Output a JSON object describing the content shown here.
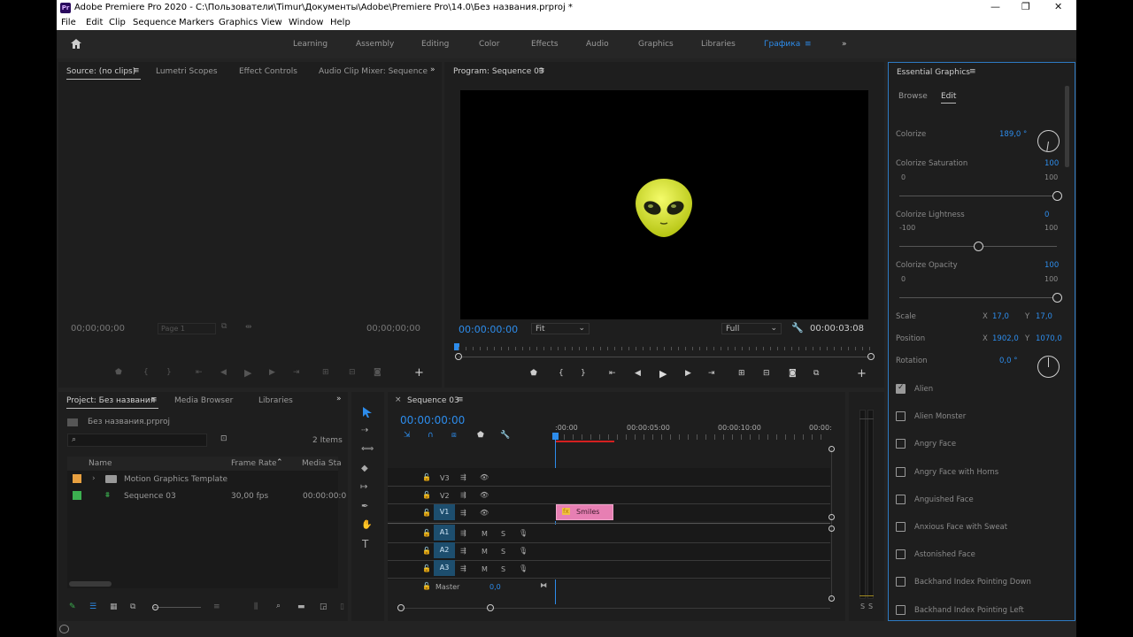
{
  "window": {
    "app_badge": "Pr",
    "title": "Adobe Premiere Pro 2020 - C:\\Пользователи\\Timur\\Документы\\Adobe\\Premiere Pro\\14.0\\Без названия.prproj *",
    "minimize": "—",
    "restore": "❐",
    "close": "✕"
  },
  "menu": [
    "File",
    "Edit",
    "Clip",
    "Sequence",
    "Markers",
    "Graphics",
    "View",
    "Window",
    "Help"
  ],
  "workspaces": [
    "Learning",
    "Assembly",
    "Editing",
    "Color",
    "Effects",
    "Audio",
    "Graphics",
    "Libraries",
    "Графика"
  ],
  "workspace_active": "Графика",
  "source_panel": {
    "tabs": [
      "Source: (no clips)",
      "Lumetri Scopes",
      "Effect Controls",
      "Audio Clip Mixer: Sequence"
    ],
    "timecode_left": "00;00;00;00",
    "page": "Page 1",
    "timecode_right": "00;00;00;00"
  },
  "program_panel": {
    "tab": "Program: Sequence 03",
    "timecode": "00:00:00:00",
    "fit": "Fit",
    "quality": "Full",
    "duration": "00:00:03:08"
  },
  "essential_graphics": {
    "title": "Essential Graphics",
    "tabs": [
      "Browse",
      "Edit"
    ],
    "colorize": {
      "label": "Colorize",
      "value": "189,0 °"
    },
    "saturation": {
      "label": "Colorize Saturation",
      "value": "100",
      "min": "0",
      "max": "100",
      "fraction": 1.0
    },
    "lightness": {
      "label": "Colorize Lightness",
      "value": "0",
      "min": "-100",
      "max": "100",
      "fraction": 0.5
    },
    "opacity": {
      "label": "Colorize Opacity",
      "value": "100",
      "min": "0",
      "max": "100",
      "fraction": 1.0
    },
    "scale": {
      "label": "Scale",
      "x_label": "X",
      "x": "17,0",
      "y_label": "Y",
      "y": "17,0"
    },
    "position": {
      "label": "Position",
      "x_label": "X",
      "x": "1902,0",
      "y_label": "Y",
      "y": "1070,0"
    },
    "rotation": {
      "label": "Rotation",
      "value": "0,0 °"
    },
    "checkboxes": [
      {
        "label": "Alien",
        "checked": true
      },
      {
        "label": "Alien Monster",
        "checked": false
      },
      {
        "label": "Angry Face",
        "checked": false
      },
      {
        "label": "Angry Face with Horns",
        "checked": false
      },
      {
        "label": "Anguished Face",
        "checked": false
      },
      {
        "label": "Anxious Face with Sweat",
        "checked": false
      },
      {
        "label": "Astonished Face",
        "checked": false
      },
      {
        "label": "Backhand Index Pointing Down",
        "checked": false
      },
      {
        "label": "Backhand Index Pointing Left",
        "checked": false
      }
    ]
  },
  "project_panel": {
    "tabs": [
      "Project: Без названия",
      "Media Browser",
      "Libraries"
    ],
    "file": "Без названия.prproj",
    "items_count": "2 Items",
    "columns": [
      "Name",
      "Frame Rate",
      "Media Sta"
    ],
    "rows": [
      {
        "name": "Motion Graphics Template",
        "frame_rate": "",
        "media": "",
        "color": "#e8a040"
      },
      {
        "name": "Sequence 03",
        "frame_rate": "30,00 fps",
        "media": "00:00:00:0",
        "color": "#3cb050"
      }
    ]
  },
  "timeline": {
    "tab": "Sequence 03",
    "timecode": "00:00:00:00",
    "ruler": [
      ":00:00",
      "00:00:05:00",
      "00:00:10:00",
      "00:00:"
    ],
    "video_tracks": [
      "V3",
      "V2",
      "V1"
    ],
    "audio_tracks": [
      "A1",
      "A2",
      "A3"
    ],
    "mute": "M",
    "solo": "S",
    "master": {
      "label": "Master",
      "value": "0,0"
    },
    "clip": {
      "label": "Smiles",
      "fx": "fx"
    }
  },
  "meter": {
    "solo_labels": [
      "S",
      "S"
    ]
  }
}
